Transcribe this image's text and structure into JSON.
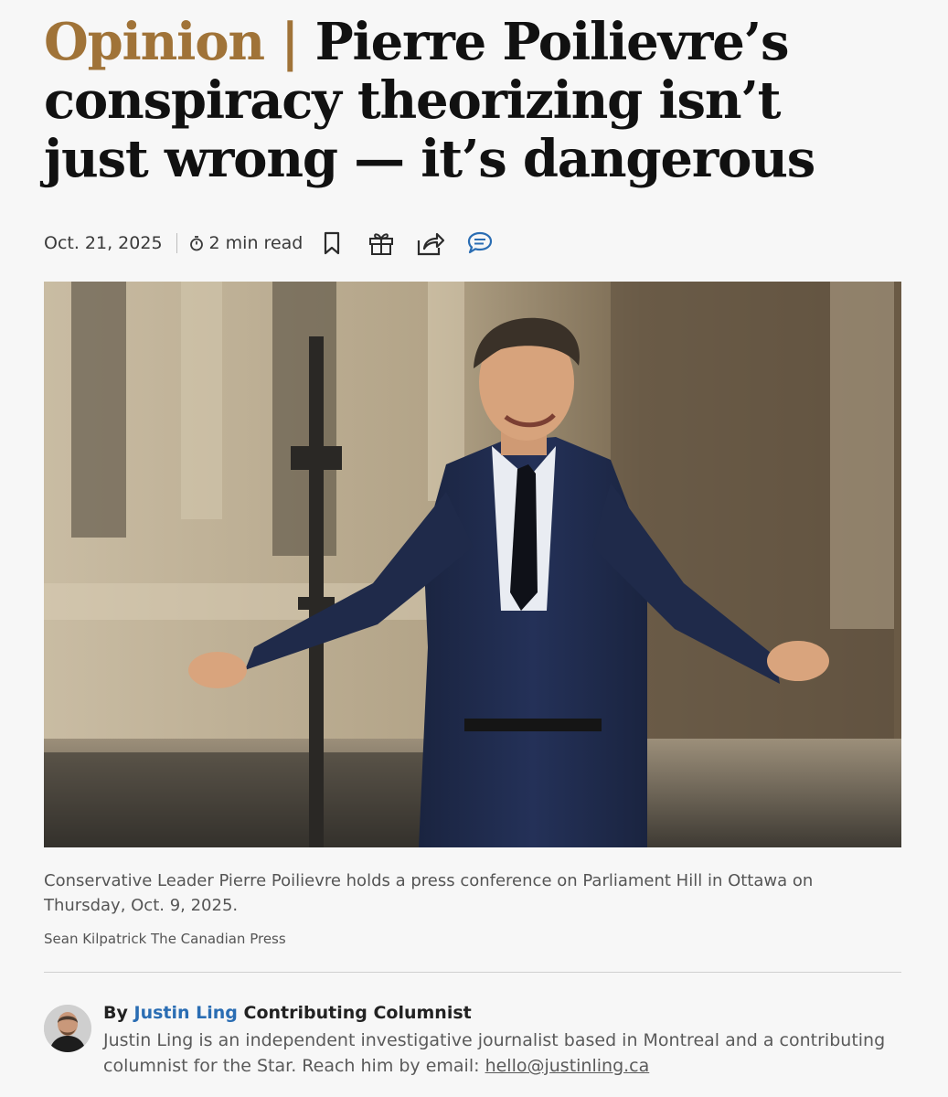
{
  "article": {
    "kicker": "Opinion |",
    "title": "Pierre Poilievre’s conspiracy theorizing isn’t just wrong — it’s dangerous",
    "date": "Oct. 21, 2025",
    "read_time": "2 min read"
  },
  "actions": {
    "icons": [
      "bookmark-icon",
      "gift-icon",
      "share-icon",
      "comment-icon"
    ],
    "comment_color": "#2a6db3"
  },
  "photo": {
    "caption": "Conservative Leader Pierre Poilievre holds a press conference on Parliament Hill in Ottawa on Thursday, Oct. 9, 2025.",
    "credit": "Sean Kilpatrick The Canadian Press"
  },
  "author": {
    "by": "By",
    "name": "Justin Ling",
    "role": "Contributing Columnist",
    "bio": "Justin Ling is an independent investigative journalist based in Montreal and a contributing columnist for the Star. Reach him by email:",
    "email": "hello@justinling.ca"
  },
  "colors": {
    "kicker": "#a07338",
    "link": "#2a6db3",
    "background": "#f7f7f7"
  }
}
